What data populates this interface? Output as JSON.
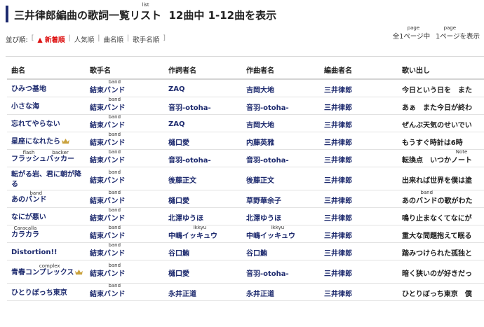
{
  "header": {
    "title_prefix": "三井律郎編曲の歌詞一覧",
    "title_ruby_base": "リスト",
    "title_ruby": "list",
    "title_suffix": "  12曲中 1-12曲を表示"
  },
  "sort": {
    "label": "並び順:",
    "open_bracket": "[",
    "close_bracket": "]",
    "active": "▲ 新着順",
    "options": [
      "人気順",
      "曲名順",
      "歌手名順"
    ]
  },
  "pager": {
    "total_prefix": "全1",
    "total_ruby_base": "ページ",
    "total_ruby": "page",
    "total_suffix": "中",
    "current_prefix": "1",
    "current_ruby_base": "ページ",
    "current_ruby": "page",
    "current_suffix": "を表示"
  },
  "table": {
    "headers": [
      "曲名",
      "歌手名",
      "作詞者名",
      "作曲者名",
      "編曲者名",
      "歌い出し"
    ],
    "band_ruby": "band",
    "rows": [
      {
        "song": "ひみつ基地",
        "singer_base": "結束",
        "singer_ruby_base": "バンド",
        "lyricist": "ZAQ",
        "composer": "吉岡大地",
        "arranger": "三井律郎",
        "lyric": "今日という日を　また"
      },
      {
        "song": "小さな海",
        "singer_base": "結束",
        "singer_ruby_base": "バンド",
        "lyricist": "音羽-otoha-",
        "composer": "音羽-otoha-",
        "arranger": "三井律郎",
        "lyric": "あぁ　また今日が終わ"
      },
      {
        "song": "忘れてやらない",
        "singer_base": "結束",
        "singer_ruby_base": "バンド",
        "lyricist": "ZAQ",
        "composer": "吉岡大地",
        "arranger": "三井律郎",
        "lyric": "ぜんぶ天気のせいでい"
      },
      {
        "song": "星座になれたら",
        "crown": true,
        "singer_base": "結束",
        "singer_ruby_base": "バンド",
        "lyricist": "樋口愛",
        "composer": "内藤英雅",
        "arranger": "三井律郎",
        "lyric": "もうすぐ時計は6時"
      },
      {
        "song_parts": [
          {
            "ruby": "flash",
            "base": "フラッシュ"
          },
          {
            "ruby": "backer",
            "base": "バッカー"
          }
        ],
        "singer_base": "結束",
        "singer_ruby_base": "バンド",
        "lyricist": "音羽-otoha-",
        "composer": "音羽-otoha-",
        "arranger": "三井律郎",
        "lyric_prefix": "転換点　いつか",
        "lyric_ruby_base": "ノート",
        "lyric_ruby": "Note"
      },
      {
        "song": "転がる岩、君に朝が降る",
        "singer_base": "結束",
        "singer_ruby_base": "バンド",
        "lyricist": "後藤正文",
        "composer": "後藤正文",
        "arranger": "三井律郎",
        "lyric": "出来れば世界を僕は塗"
      },
      {
        "song_prefix": "あの",
        "song_ruby_base": "バンド",
        "song_ruby": "band",
        "singer_base": "結束",
        "singer_ruby_base": "バンド",
        "lyricist": "樋口愛",
        "composer": "草野華余子",
        "arranger": "三井律郎",
        "lyric_prefix": "あの",
        "lyric_ruby_base": "バンド",
        "lyric_ruby": "band",
        "lyric_suffix": "の歌がわた"
      },
      {
        "song": "なにが悪い",
        "singer_base": "結束",
        "singer_ruby_base": "バンド",
        "lyricist": "北澤ゆうほ",
        "composer": "北澤ゆうほ",
        "arranger": "三井律郎",
        "lyric": "鳴り止まなくてなにが"
      },
      {
        "song_ruby_base": "カラカラ",
        "song_ruby": "Caracalla",
        "singer_base": "結束",
        "singer_ruby_base": "バンド",
        "lyricist_prefix": "中嶋",
        "lyricist_ruby_base": "イッキュウ",
        "lyricist_ruby": "Ikkyu",
        "composer_prefix": "中嶋",
        "composer_ruby_base": "イッキュウ",
        "composer_ruby": "Ikkyu",
        "arranger": "三井律郎",
        "lyric": "重大な問題抱えて眠る"
      },
      {
        "song": "Distortion!!",
        "singer_base": "結束",
        "singer_ruby_base": "バンド",
        "lyricist": "谷口鮪",
        "composer": "谷口鮪",
        "arranger": "三井律郎",
        "lyric": "踏みつけられた孤独と"
      },
      {
        "song_prefix": "青春",
        "song_ruby_base": "コンプレックス",
        "song_ruby": "complex",
        "crown": true,
        "singer_base": "結束",
        "singer_ruby_base": "バンド",
        "lyricist": "樋口愛",
        "composer": "音羽-otoha-",
        "arranger": "三井律郎",
        "lyric": "暗く狭いのが好きだっ"
      },
      {
        "song": "ひとりぼっち東京",
        "singer_base": "結束",
        "singer_ruby_base": "バンド",
        "lyricist": "永井正道",
        "composer": "永井正道",
        "arranger": "三井律郎",
        "lyric": "ひとりぼっち東京　僕"
      }
    ]
  },
  "colors": {
    "accent": "#1d2a6e",
    "active_sort": "#dd1111",
    "crown": "#c9a13b"
  }
}
